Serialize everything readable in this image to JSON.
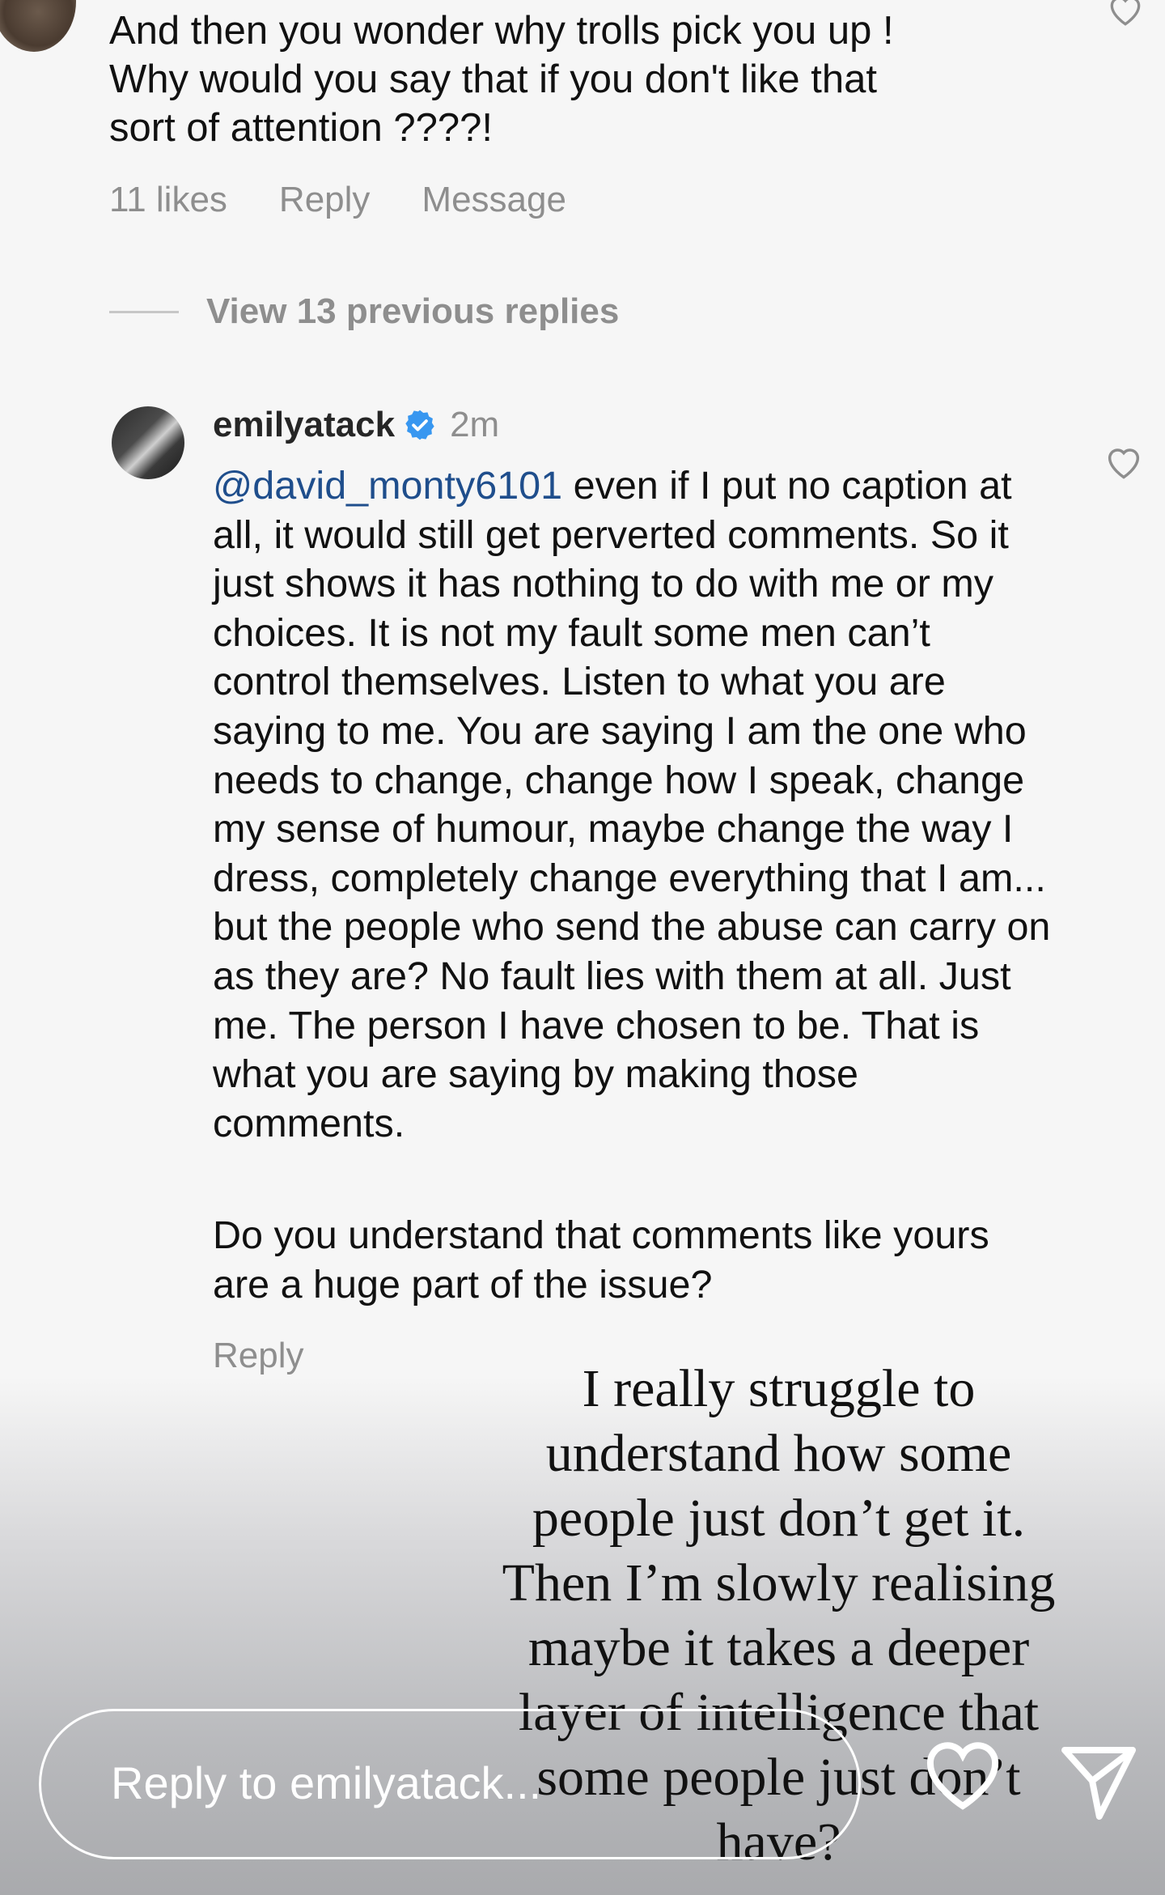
{
  "top_comment": {
    "text": "And then you wonder why trolls pick you up !\nWhy would you say that if you don't like that\nsort of attention ????!",
    "likes": "11 likes",
    "reply_label": "Reply",
    "message_label": "Message",
    "like_icon": "heart-outline-icon"
  },
  "view_previous_replies": "View 13 previous replies",
  "reply": {
    "username": "emilyatack",
    "verified_icon": "verified-badge-icon",
    "time": "2m",
    "mention": "@david_monty6101",
    "body": " even if I put no caption at all, it would still get perverted comments. So it just shows it has nothing to do with me or my choices. It is not my fault some men can’t control themselves. Listen to what you are saying to me. You are saying I am the one who needs to change, change how I speak, change my sense of humour, maybe change the way I dress, completely change everything that I am... but the people who send the abuse can carry on as they are? No fault lies with them at all. Just me. The person I have chosen to be. That is what you are saying by making those comments.",
    "body2": "Do you understand that comments like yours are a huge part of the issue?",
    "reply_label": "Reply",
    "like_icon": "heart-outline-icon"
  },
  "story_overlay": {
    "lines": [
      "I really struggle to",
      "understand how some",
      "people just don’t get it.",
      "Then I’m slowly realising",
      "maybe it takes a deeper",
      "layer of intelligence that",
      "some people just don’t",
      "have?"
    ]
  },
  "bottom_bar": {
    "placeholder": "Reply to emilyatack...",
    "heart_icon": "heart-icon",
    "send_icon": "send-icon"
  },
  "colors": {
    "mention": "#1f4e8c",
    "verified": "#3897f0",
    "muted": "#8e8e8e"
  }
}
